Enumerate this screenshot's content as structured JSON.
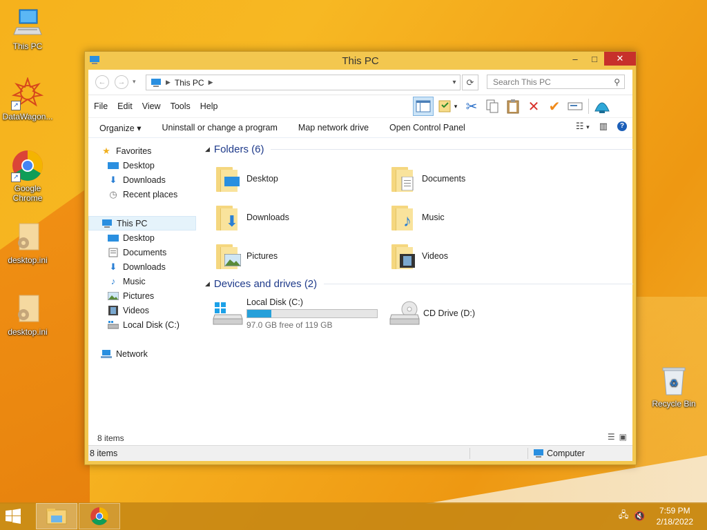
{
  "desktop": {
    "icons": [
      {
        "label": "This PC"
      },
      {
        "label": "DataWagon..."
      },
      {
        "label": "Google Chrome"
      },
      {
        "label": "desktop.ini"
      },
      {
        "label": "desktop.ini"
      },
      {
        "label": "Recycle Bin"
      }
    ]
  },
  "window": {
    "title": "This PC",
    "controls": {
      "minimize": "–",
      "maximize": "□",
      "close": "✕"
    },
    "address": {
      "crumb": "This PC",
      "search_placeholder": "Search This PC"
    },
    "menu": [
      "File",
      "Edit",
      "View",
      "Tools",
      "Help"
    ],
    "commands": [
      "Organize ▾",
      "Uninstall or change a program",
      "Map network drive",
      "Open Control Panel"
    ],
    "nav": {
      "favorites": {
        "label": "Favorites",
        "items": [
          "Desktop",
          "Downloads",
          "Recent places"
        ]
      },
      "this_pc": {
        "label": "This PC",
        "items": [
          "Desktop",
          "Documents",
          "Downloads",
          "Music",
          "Pictures",
          "Videos",
          "Local Disk (C:)"
        ]
      },
      "network": {
        "label": "Network"
      }
    },
    "folders": {
      "heading": "Folders (6)",
      "items": [
        "Desktop",
        "Documents",
        "Downloads",
        "Music",
        "Pictures",
        "Videos"
      ]
    },
    "devices": {
      "heading": "Devices and drives (2)",
      "local_disk": {
        "name": "Local Disk (C:)",
        "free_text": "97.0 GB free of 119 GB",
        "used_fraction": 0.185
      },
      "cd_drive": {
        "name": "CD Drive (D:)"
      }
    },
    "footer_count": "8 items",
    "status": {
      "count": "8 items",
      "location": "Computer"
    }
  },
  "taskbar": {
    "time": "7:59 PM",
    "date": "2/18/2022"
  },
  "colors": {
    "accent": "#26a0da",
    "heading": "#1e3a8a",
    "close": "#c7302b"
  }
}
